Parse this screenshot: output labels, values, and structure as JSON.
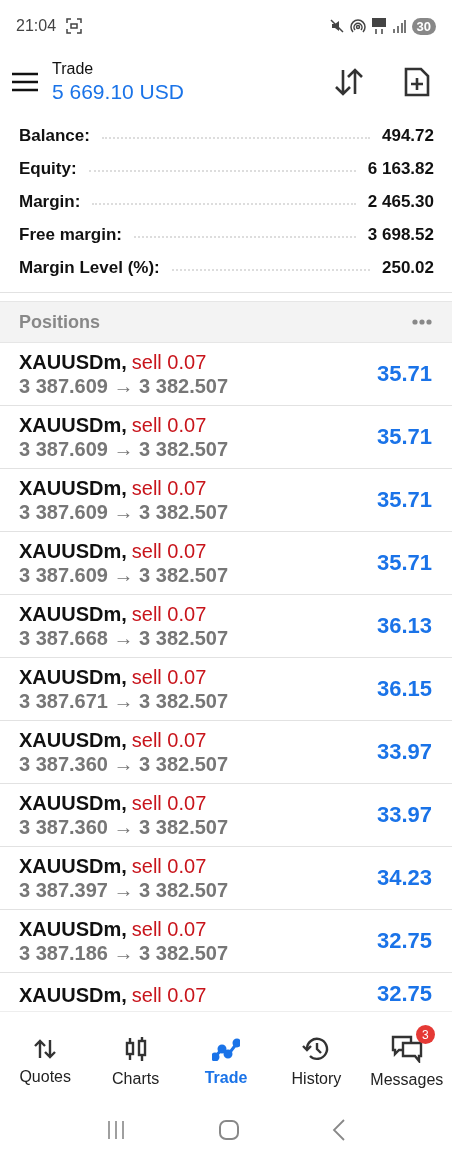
{
  "status_bar": {
    "time": "21:04",
    "battery": "30"
  },
  "header": {
    "title": "Trade",
    "balance": "5 669.10 USD"
  },
  "summary": [
    {
      "label": "Balance:",
      "value": "494.72"
    },
    {
      "label": "Equity:",
      "value": "6 163.82"
    },
    {
      "label": "Margin:",
      "value": "2 465.30"
    },
    {
      "label": "Free margin:",
      "value": "3 698.52"
    },
    {
      "label": "Margin Level (%):",
      "value": "250.02"
    }
  ],
  "positions": {
    "title": "Positions",
    "rows": [
      {
        "symbol": "XAUUSDm,",
        "side": "sell 0.07",
        "prices": "3 387.609 → 3 382.507",
        "profit": "35.71"
      },
      {
        "symbol": "XAUUSDm,",
        "side": "sell 0.07",
        "prices": "3 387.609 → 3 382.507",
        "profit": "35.71"
      },
      {
        "symbol": "XAUUSDm,",
        "side": "sell 0.07",
        "prices": "3 387.609 → 3 382.507",
        "profit": "35.71"
      },
      {
        "symbol": "XAUUSDm,",
        "side": "sell 0.07",
        "prices": "3 387.609 → 3 382.507",
        "profit": "35.71"
      },
      {
        "symbol": "XAUUSDm,",
        "side": "sell 0.07",
        "prices": "3 387.668 → 3 382.507",
        "profit": "36.13"
      },
      {
        "symbol": "XAUUSDm,",
        "side": "sell 0.07",
        "prices": "3 387.671 → 3 382.507",
        "profit": "36.15"
      },
      {
        "symbol": "XAUUSDm,",
        "side": "sell 0.07",
        "prices": "3 387.360 → 3 382.507",
        "profit": "33.97"
      },
      {
        "symbol": "XAUUSDm,",
        "side": "sell 0.07",
        "prices": "3 387.360 → 3 382.507",
        "profit": "33.97"
      },
      {
        "symbol": "XAUUSDm,",
        "side": "sell 0.07",
        "prices": "3 387.397 → 3 382.507",
        "profit": "34.23"
      },
      {
        "symbol": "XAUUSDm,",
        "side": "sell 0.07",
        "prices": "3 387.186 → 3 382.507",
        "profit": "32.75"
      },
      {
        "symbol": "XAUUSDm,",
        "side": "sell 0.07",
        "profit": "32.75"
      }
    ]
  },
  "nav": [
    {
      "kind": "quotes",
      "label": "Quotes",
      "selected": false
    },
    {
      "kind": "charts",
      "label": "Charts",
      "selected": false
    },
    {
      "kind": "trade",
      "label": "Trade",
      "selected": true
    },
    {
      "kind": "history",
      "label": "History",
      "selected": false
    },
    {
      "kind": "messages",
      "label": "Messages",
      "selected": false,
      "badge": "3"
    }
  ]
}
